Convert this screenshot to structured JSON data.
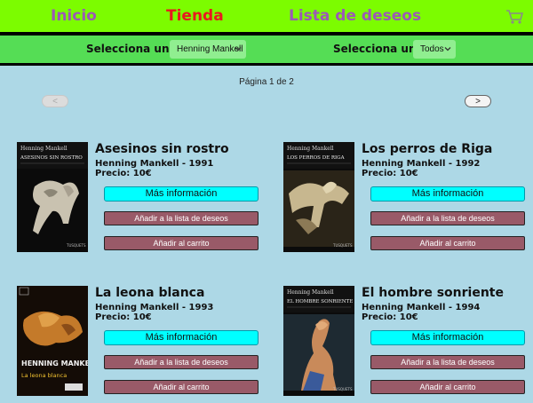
{
  "nav": {
    "inicio": "Inicio",
    "tienda": "Tienda",
    "deseos": "Lista de deseos",
    "cart_icon": "shopping-cart-icon"
  },
  "filters": {
    "author_label": "Selecciona un autor",
    "author_value": "Henning Mankell",
    "country_label": "Selecciona un país",
    "country_value": "Todos"
  },
  "pagination": {
    "info": "Página 1 de 2",
    "prev": "<",
    "next": ">"
  },
  "colors": {
    "background": "#add8e6",
    "nav_bg": "#7cfc00",
    "filter_bg": "#55dd55",
    "active_nav": "#e8191f",
    "inactive_nav": "#9b59b6",
    "info_button": "#00ffff",
    "action_button": "#995a68"
  },
  "buttons": {
    "info": "Más información",
    "wish": "Añadir a la lista de deseos",
    "cart": "Añadir al carrito"
  },
  "books": [
    {
      "title": "Asesinos sin rostro",
      "author_year": "Henning Mankell - 1991",
      "price": "Precio: 10€",
      "cover_author": "Henning Mankell",
      "cover_title": "ASESINOS SIN ROSTRO"
    },
    {
      "title": "Los perros de Riga",
      "author_year": "Henning Mankell - 1992",
      "price": "Precio: 10€",
      "cover_author": "Henning Mankell",
      "cover_title": "LOS PERROS DE RIGA"
    },
    {
      "title": "La leona blanca",
      "author_year": "Henning Mankell - 1993",
      "price": "Precio: 10€",
      "cover_author": "HENNING MANKELL",
      "cover_title": "La leona blanca"
    },
    {
      "title": "El hombre sonriente",
      "author_year": "Henning Mankell - 1994",
      "price": "Precio: 10€",
      "cover_author": "Henning Mankell",
      "cover_title": "EL HOMBRE SONRIENTE"
    }
  ]
}
